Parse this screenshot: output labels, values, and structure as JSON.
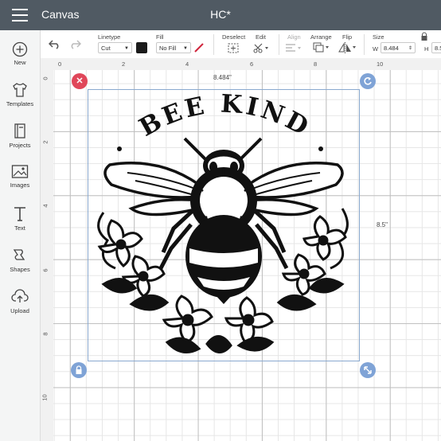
{
  "app": {
    "title": "Canvas",
    "project_name": "HC*"
  },
  "toolbar": {
    "linetype_label": "Linetype",
    "linetype_value": "Cut",
    "fill_label": "Fill",
    "fill_value": "No Fill",
    "deselect_label": "Deselect",
    "edit_label": "Edit",
    "align_label": "Align",
    "arrange_label": "Arrange",
    "flip_label": "Flip",
    "size_label": "Size",
    "w_label": "W",
    "w_value": "8.484",
    "h_label": "H",
    "h_value": "8.5",
    "linetype_color": "#1b1b1b",
    "fill_slash_color": "#d0243b"
  },
  "sidebar": {
    "items": [
      {
        "label": "New",
        "icon": "plus-icon"
      },
      {
        "label": "Templates",
        "icon": "shirt-icon"
      },
      {
        "label": "Projects",
        "icon": "book-icon"
      },
      {
        "label": "Images",
        "icon": "image-icon"
      },
      {
        "label": "Text",
        "icon": "text-icon"
      },
      {
        "label": "Shapes",
        "icon": "shapes-icon"
      },
      {
        "label": "Upload",
        "icon": "upload-icon"
      }
    ]
  },
  "ruler": {
    "top": [
      "0",
      "2",
      "4",
      "6",
      "8",
      "10"
    ],
    "left": [
      "0",
      "2",
      "4",
      "6",
      "8",
      "10"
    ]
  },
  "selection": {
    "width_label": "8.484\"",
    "height_label": "8.5\"",
    "delete_color": "#e0475a",
    "handle_color": "#7fa3d6"
  },
  "design": {
    "text": "BEE KIND"
  }
}
